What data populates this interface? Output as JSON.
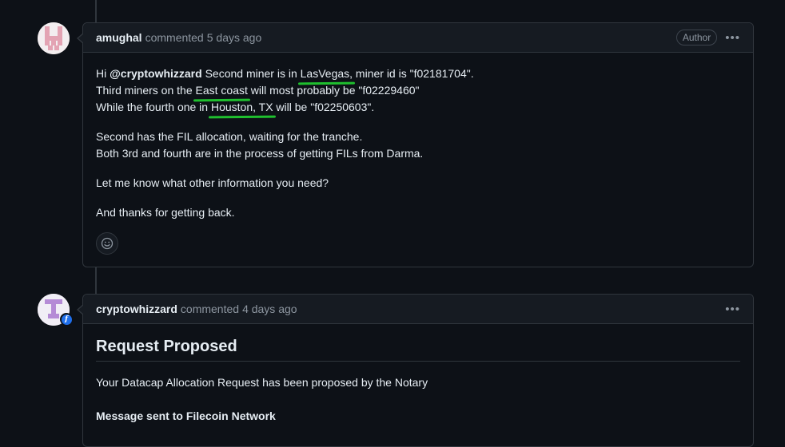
{
  "comments": [
    {
      "author": "amughal",
      "action": "commented",
      "time": "5 days ago",
      "role": "Author",
      "body": {
        "greeting": "Hi ",
        "mention": "@cryptowhizzard",
        "l1_a": " Second miner is in ",
        "l1_place": "LasVegas,",
        "l1_b": " miner id is \"f02181704\".",
        "l2_a": "Third miners on the ",
        "l2_place": "East coast",
        "l2_b": " will most probably be \"f02229460\"",
        "l3_a": "While the fourth one in ",
        "l3_place": "Houston, TX",
        "l3_b": " will be \"f02250603\".",
        "p2_l1": "Second has the FIL allocation, waiting for the tranche.",
        "p2_l2": "Both 3rd and fourth are in the process of getting FILs from Darma.",
        "p3": "Let me know what other information you need?",
        "p4": "And thanks for getting back."
      }
    },
    {
      "author": "cryptowhizzard",
      "action": "commented",
      "time": "4 days ago",
      "body": {
        "title": "Request Proposed",
        "p1": "Your Datacap Allocation Request has been proposed by the Notary",
        "p2": "Message sent to Filecoin Network"
      }
    }
  ],
  "icons": {
    "more": "kebab-horizontal-icon",
    "reaction": "smiley-icon",
    "badge": "filecoin-icon"
  },
  "colors": {
    "background": "#0d1117",
    "header": "#161b22",
    "border": "#30363d",
    "text": "#e6edf3",
    "muted": "#8d96a0",
    "annotation": "#1fbf2e"
  }
}
